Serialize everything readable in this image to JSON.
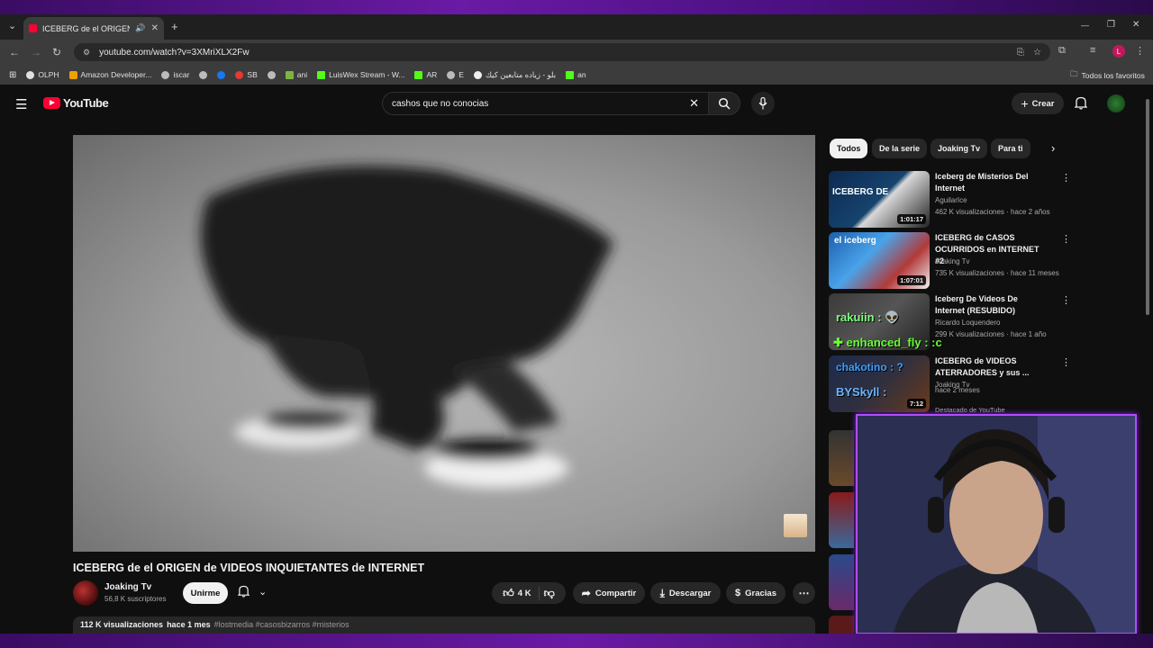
{
  "browser": {
    "tab_title": "ICEBERG de el ORIGEN de VIDEOS INQUIETANTES de INTERNET",
    "url": "youtube.com/watch?v=3XMriXLX2Fw",
    "bookmarks": [
      "OLPH",
      "Amazon Developer...",
      "iscar",
      "",
      "SB",
      "ani",
      "LuisWex Stream - W...",
      "AR",
      "E",
      "بلو - زياده متابعين كيك",
      "an"
    ],
    "all_bookmarks": "Todos los favoritos",
    "profile_initial": "L"
  },
  "youtube": {
    "logo_text": "YouTube",
    "search_query": "cashos que no conocias",
    "create_label": "Crear"
  },
  "video": {
    "title": "ICEBERG de el ORIGEN de VIDEOS INQUIETANTES de INTERNET",
    "channel": "Joaking Tv",
    "subscribers": "56,8 K suscriptores",
    "join_label": "Unirme",
    "likes": "4 K",
    "share_label": "Compartir",
    "download_label": "Descargar",
    "thanks_label": "Gracias",
    "views": "112 K visualizaciones",
    "age": "hace 1 mes",
    "tags": "#lostmedia #casosbizarros #misterios"
  },
  "chips": [
    "Todos",
    "De la serie",
    "Joaking Tv",
    "Para ti"
  ],
  "recommendations": [
    {
      "title": "Iceberg de Misterios Del Internet",
      "channel": "AguilarIce",
      "meta": "462 K visualizaciones · hace 2 años",
      "duration": "1:01:17",
      "thumb_text": "ICEBERG DE"
    },
    {
      "title": "ICEBERG de CASOS OCURRIDOS en INTERNET #2",
      "channel": "Joaking Tv",
      "meta": "735 K visualizaciones · hace 11 meses",
      "duration": "1:07:01",
      "thumb_text": "el iceberg"
    },
    {
      "title": "Iceberg De Videos De Internet (RESUBIDO)",
      "channel": "Ricardo Loquendero",
      "meta": "299 K visualizaciones · hace 1 año",
      "duration": "",
      "thumb_text": ""
    },
    {
      "title": "ICEBERG de VIDEOS ATERRADORES y sus ...",
      "channel": "Joaking Tv",
      "meta": "hace 2 meses",
      "duration": "7:12",
      "thumb_text": "",
      "badge": "Destacado de YouTube"
    }
  ],
  "chat_overlay": {
    "line1": "rakuiin : 👽",
    "line2": "✚ enhanced_fly : :c",
    "line3": "chakotino : ?",
    "line4": "BYSkyll : "
  },
  "colors": {
    "youtube_red": "#ff0033",
    "webcam_border": "#b14cff",
    "page_bg": "#0f0f0f"
  }
}
